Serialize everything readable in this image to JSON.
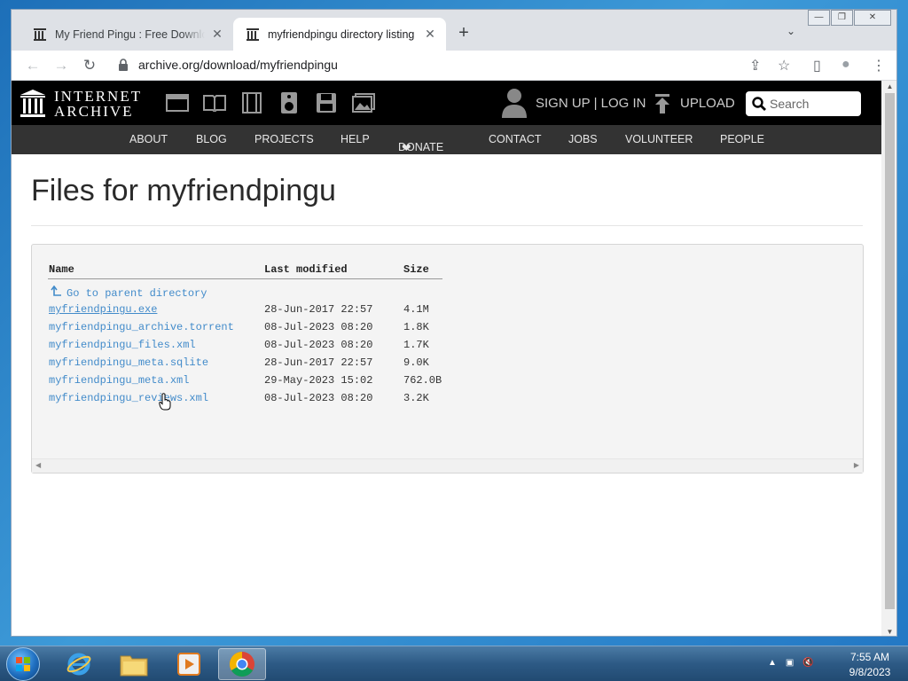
{
  "browser": {
    "tabs": [
      {
        "title": "My Friend Pingu : Free Download",
        "close": "✕"
      },
      {
        "title": "myfriendpingu directory listing",
        "close": "✕"
      }
    ],
    "new_tab": "+",
    "tab_search": "⌄",
    "url": "archive.org/download/myfriendpingu",
    "window_controls": {
      "minimize": "—",
      "maximize": "❐",
      "close": "✕"
    },
    "nav": {
      "back": "←",
      "forward": "→",
      "reload": "↻"
    },
    "toolbar_icons": {
      "share": "⇪",
      "bookmark": "☆",
      "sidepanel": "▯",
      "profile": "●",
      "menu": "⋮"
    }
  },
  "ia": {
    "logo_line1": "INTERNET",
    "logo_line2": "ARCHIVE",
    "auth": "SIGN UP | LOG IN",
    "upload": "UPLOAD",
    "search_placeholder": "Search",
    "nav": [
      "ABOUT",
      "BLOG",
      "PROJECTS",
      "HELP",
      "DONATE",
      "CONTACT",
      "JOBS",
      "VOLUNTEER",
      "PEOPLE"
    ],
    "donate_heart": "❤"
  },
  "page": {
    "title": "Files for myfriendpingu",
    "columns": {
      "name": "Name",
      "modified": "Last modified",
      "size": "Size"
    },
    "parent_link": "Go to parent directory",
    "files": [
      {
        "name": "myfriendpingu.exe",
        "modified": "28-Jun-2017 22:57",
        "size": "4.1M"
      },
      {
        "name": "myfriendpingu_archive.torrent",
        "modified": "08-Jul-2023 08:20",
        "size": "1.8K"
      },
      {
        "name": "myfriendpingu_files.xml",
        "modified": "08-Jul-2023 08:20",
        "size": "1.7K"
      },
      {
        "name": "myfriendpingu_meta.sqlite",
        "modified": "28-Jun-2017 22:57",
        "size": "9.0K"
      },
      {
        "name": "myfriendpingu_meta.xml",
        "modified": "29-May-2023 15:02",
        "size": "762.0B"
      },
      {
        "name": "myfriendpingu_reviews.xml",
        "modified": "08-Jul-2023 08:20",
        "size": "3.2K"
      }
    ]
  },
  "taskbar": {
    "time": "7:55 AM",
    "date": "9/8/2023",
    "tray_icons": [
      "▲",
      "▣",
      "🔇"
    ]
  },
  "colors": {
    "link": "#428bca",
    "ia_black": "#000000",
    "ia_nav": "#333333",
    "donate": "#ee1111"
  }
}
